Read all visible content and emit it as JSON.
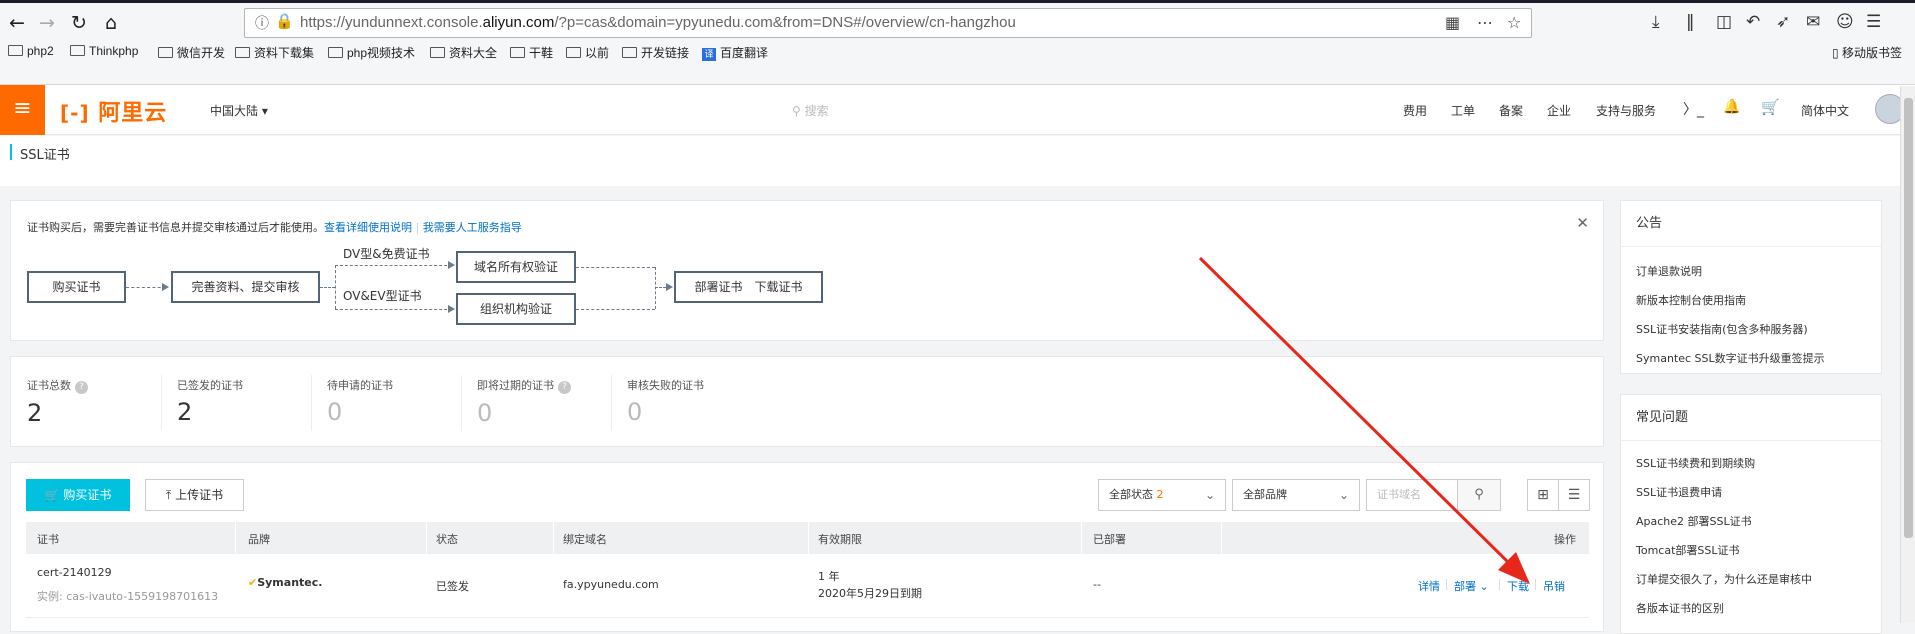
{
  "browser": {
    "url_prefix": "https://yundunnext.console.",
    "url_domain": "aliyun.com",
    "url_suffix": "/?p=cas&domain=ypyunedu.com&from=DNS#/overview/cn-hangzhou",
    "bookmarks": [
      "php2",
      "Thinkphp",
      "微信开发",
      "资料下载集",
      "php视频技术",
      "资料大全",
      "干鞋",
      "以前",
      "开发链接",
      "百度翻译"
    ],
    "mobile_bookmarks": "移动版书签"
  },
  "console": {
    "logo": "阿里云",
    "region": "中国大陆",
    "search_placeholder": "搜索",
    "nav": [
      "费用",
      "工单",
      "备案",
      "企业",
      "支持与服务"
    ],
    "language": "简体中文"
  },
  "page": {
    "title": "SSL证书"
  },
  "notice": {
    "message": "证书购买后，需要完善证书信息并提交审核通过后才能使用。",
    "link1": "查看详细使用说明",
    "link2": "我需要人工服务指导",
    "steps": {
      "buy": "购买证书",
      "complete": "完善资料、提交审核",
      "dv": "DV型&免费证书",
      "ov": "OV&EV型证书",
      "domain_verify": "域名所有权验证",
      "org_verify": "组织机构验证",
      "deploy": "部署证书　下载证书"
    }
  },
  "stats": [
    {
      "label": "证书总数",
      "value": "2",
      "help": true
    },
    {
      "label": "已签发的证书",
      "value": "2",
      "help": false
    },
    {
      "label": "待申请的证书",
      "value": "0",
      "help": false
    },
    {
      "label": "即将过期的证书",
      "value": "0",
      "help": true
    },
    {
      "label": "审核失败的证书",
      "value": "0",
      "help": false
    }
  ],
  "list": {
    "buy_button": "购买证书",
    "upload_button": "上传证书",
    "status_filter_label": "全部状态",
    "status_filter_count": "2",
    "brand_filter": "全部品牌",
    "domain_placeholder": "证书域名",
    "columns": [
      "证书",
      "品牌",
      "状态",
      "绑定域名",
      "有效期限",
      "已部署",
      "操作"
    ],
    "rows": [
      {
        "name": "cert-2140129",
        "instance": "实例: cas-ivauto-1559198701613",
        "brand": "Symantec.",
        "status": "已签发",
        "domain": "fa.ypyunedu.com",
        "validity": "1 年",
        "expiry": "2020年5月29日到期",
        "deployed": "--",
        "actions": {
          "detail": "详情",
          "deploy": "部署",
          "download": "下载",
          "revoke": "吊销"
        }
      }
    ]
  },
  "announcements": {
    "title": "公告",
    "items": [
      "订单退款说明",
      "新版本控制台使用指南",
      "SSL证书安装指南(包含多种服务器)",
      "Symantec SSL数字证书升级重签提示"
    ]
  },
  "faq": {
    "title": "常见问题",
    "items": [
      "SSL证书续费和到期续购",
      "SSL证书退费申请",
      "Apache2 部署SSL证书",
      "Tomcat部署SSL证书",
      "订单提交很久了，为什么还是审核中",
      "各版本证书的区别"
    ]
  },
  "colors": {
    "accent": "#00c1de",
    "brand": "#ff6a00",
    "link": "#0070cc",
    "annotation": "#e8271b"
  }
}
